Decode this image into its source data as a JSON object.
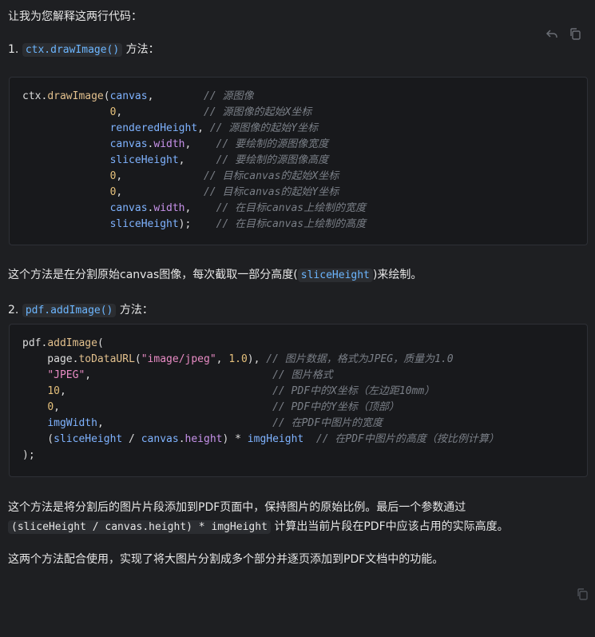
{
  "intro": "让我为您解释这两行代码：",
  "section1": {
    "num": "1.",
    "code": "ctx.drawImage()",
    "suffix": "方法："
  },
  "code1": [
    [
      [
        "ctx.",
        "def"
      ],
      [
        "drawImage",
        "fn"
      ],
      [
        "(",
        "def"
      ],
      [
        "canvas",
        "var"
      ],
      [
        ",        ",
        "def"
      ],
      [
        "// 源图像",
        "com"
      ]
    ],
    [
      [
        "              ",
        "def"
      ],
      [
        "0",
        "num"
      ],
      [
        ",             ",
        "def"
      ],
      [
        "// 源图像的起始X坐标",
        "com"
      ]
    ],
    [
      [
        "              ",
        "def"
      ],
      [
        "renderedHeight",
        "var"
      ],
      [
        ", ",
        "def"
      ],
      [
        "// 源图像的起始Y坐标",
        "com"
      ]
    ],
    [
      [
        "              ",
        "def"
      ],
      [
        "canvas",
        "var"
      ],
      [
        ".",
        "def"
      ],
      [
        "width",
        "prop"
      ],
      [
        ",    ",
        "def"
      ],
      [
        "// 要绘制的源图像宽度",
        "com"
      ]
    ],
    [
      [
        "              ",
        "def"
      ],
      [
        "sliceHeight",
        "var"
      ],
      [
        ",     ",
        "def"
      ],
      [
        "// 要绘制的源图像高度",
        "com"
      ]
    ],
    [
      [
        "              ",
        "def"
      ],
      [
        "0",
        "num"
      ],
      [
        ",             ",
        "def"
      ],
      [
        "// 目标canvas的起始X坐标",
        "com"
      ]
    ],
    [
      [
        "              ",
        "def"
      ],
      [
        "0",
        "num"
      ],
      [
        ",             ",
        "def"
      ],
      [
        "// 目标canvas的起始Y坐标",
        "com"
      ]
    ],
    [
      [
        "              ",
        "def"
      ],
      [
        "canvas",
        "var"
      ],
      [
        ".",
        "def"
      ],
      [
        "width",
        "prop"
      ],
      [
        ",    ",
        "def"
      ],
      [
        "// 在目标canvas上绘制的宽度",
        "com"
      ]
    ],
    [
      [
        "              ",
        "def"
      ],
      [
        "sliceHeight",
        "var"
      ],
      [
        ");    ",
        "def"
      ],
      [
        "// 在目标canvas上绘制的高度",
        "com"
      ]
    ]
  ],
  "para1": {
    "before": "这个方法是在分割原始canvas图像，每次截取一部分高度(",
    "code": "sliceHeight",
    "after": ")来绘制。"
  },
  "section2": {
    "num": "2.",
    "code": "pdf.addImage()",
    "suffix": "方法："
  },
  "code2": [
    [
      [
        "pdf.",
        "def"
      ],
      [
        "addImage",
        "fn"
      ],
      [
        "(",
        "def"
      ]
    ],
    [
      [
        "    page.",
        "def"
      ],
      [
        "toDataURL",
        "fn"
      ],
      [
        "(",
        "def"
      ],
      [
        "\"image/jpeg\"",
        "str"
      ],
      [
        ", ",
        "def"
      ],
      [
        "1.0",
        "num"
      ],
      [
        "), ",
        "def"
      ],
      [
        "// 图片数据，格式为JPEG，质量为1.0",
        "com"
      ]
    ],
    [
      [
        "    ",
        "def"
      ],
      [
        "\"JPEG\"",
        "str"
      ],
      [
        ",                             ",
        "def"
      ],
      [
        "// 图片格式",
        "com"
      ]
    ],
    [
      [
        "    ",
        "def"
      ],
      [
        "10",
        "num"
      ],
      [
        ",                                 ",
        "def"
      ],
      [
        "// PDF中的X坐标（左边距10mm）",
        "com"
      ]
    ],
    [
      [
        "    ",
        "def"
      ],
      [
        "0",
        "num"
      ],
      [
        ",                                  ",
        "def"
      ],
      [
        "// PDF中的Y坐标（顶部）",
        "com"
      ]
    ],
    [
      [
        "    ",
        "def"
      ],
      [
        "imgWidth",
        "var"
      ],
      [
        ",                           ",
        "def"
      ],
      [
        "// 在PDF中图片的宽度",
        "com"
      ]
    ],
    [
      [
        "    (",
        "def"
      ],
      [
        "sliceHeight",
        "var"
      ],
      [
        " / ",
        "def"
      ],
      [
        "canvas",
        "var"
      ],
      [
        ".",
        "def"
      ],
      [
        "height",
        "prop"
      ],
      [
        ") * ",
        "def"
      ],
      [
        "imgHeight",
        "var"
      ],
      [
        "  ",
        "def"
      ],
      [
        "// 在PDF中图片的高度（按比例计算）",
        "com"
      ]
    ],
    [
      [
        ");",
        "def"
      ]
    ]
  ],
  "para2": {
    "line1": "这个方法是将分割后的图片片段添加到PDF页面中，保持图片的原始比例。最后一个参数通过",
    "code": "(sliceHeight / canvas.height) * imgHeight",
    "after": "计算出当前片段在PDF中应该占用的实际高度。"
  },
  "para3": "这两个方法配合使用，实现了将大图片分割成多个部分并逐页添加到PDF文档中的功能。"
}
